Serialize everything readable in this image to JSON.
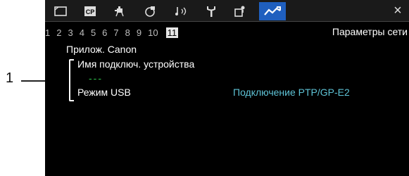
{
  "callout": {
    "number": "1"
  },
  "tabs": [
    {
      "icon": "film-icon",
      "active": false
    },
    {
      "icon": "cp-icon",
      "active": false
    },
    {
      "icon": "camera-icon",
      "active": false
    },
    {
      "icon": "custom-button-icon",
      "active": false
    },
    {
      "icon": "audio-icon",
      "active": false
    },
    {
      "icon": "wrench-icon",
      "active": false
    },
    {
      "icon": "my-menu-icon",
      "active": false
    },
    {
      "icon": "network-icon",
      "active": true
    }
  ],
  "close_label": "×",
  "page_numbers": [
    "1",
    "2",
    "3",
    "4",
    "5",
    "6",
    "7",
    "8",
    "9",
    "10",
    "11"
  ],
  "current_page": "11",
  "screen_title": "Параметры сети",
  "menu": {
    "canon_app": "Прилож. Canon",
    "device_name_label": "Имя подключ. устройства",
    "device_name_value": "---",
    "usb_mode_label": "Режим USB",
    "usb_mode_value": "Подключение PTP/GP-E2"
  },
  "colors": {
    "active_tab": "#1f5fbf",
    "value_text": "#5ec3d6",
    "device_value_text": "#2fbf4a"
  }
}
